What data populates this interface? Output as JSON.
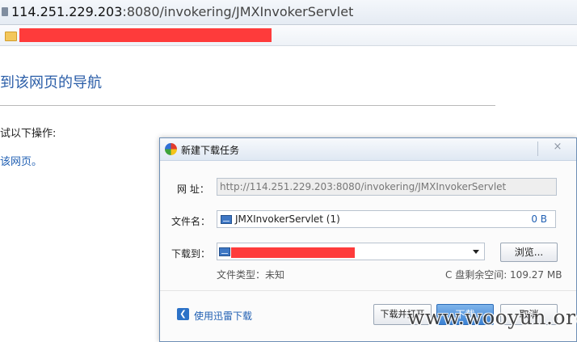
{
  "browser": {
    "url_host": "114.251.229.203",
    "url_rest": ":8080/invokering/JMXInvokerServlet"
  },
  "error_page": {
    "title": "到该网页的导航",
    "try_text": "试以下操作:",
    "link_text": "该网页。"
  },
  "dialog": {
    "title": "新建下载任务",
    "close_glyph": "×",
    "url_label": "网  址：",
    "url_value": "http://114.251.229.203:8080/invokering/JMXInvokerServlet",
    "filename_label": "文件名：",
    "filename_value": "JMXInvokerServlet (1)",
    "file_size": "0 B",
    "save_to_label": "下载到：",
    "browse_label": "浏览...",
    "file_type": "文件类型：未知",
    "disk_space": "C 盘剩余空间: 109.27 MB",
    "xunlei_link": "使用迅雷下载",
    "download_open_label": "下载并打开",
    "download_label": "下载",
    "cancel_label": "取消"
  },
  "watermark": "www.wooyun.org",
  "colors": {
    "link": "#2160b3",
    "redaction": "#fe3b3b",
    "primary_button": "#3b82d4"
  }
}
